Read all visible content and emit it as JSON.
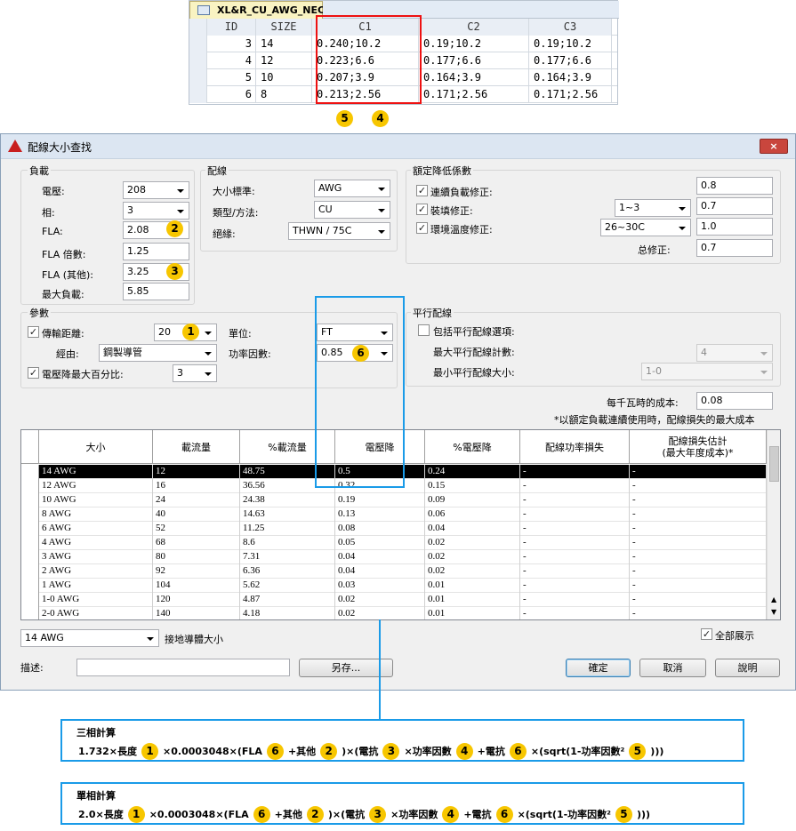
{
  "access_table": {
    "tab_title": "XL&R_CU_AWG_NEC",
    "columns": [
      "ID",
      "SIZE",
      "C1",
      "C2",
      "C3"
    ],
    "rows": [
      [
        "3",
        "14",
        "0.240;10.2",
        "0.19;10.2",
        "0.19;10.2"
      ],
      [
        "4",
        "12",
        "0.223;6.6",
        "0.177;6.6",
        "0.177;6.6"
      ],
      [
        "5",
        "10",
        "0.207;3.9",
        "0.164;3.9",
        "0.164;3.9"
      ],
      [
        "6",
        "8",
        "0.213;2.56",
        "0.171;2.56",
        "0.171;2.56"
      ]
    ],
    "callouts": [
      "5",
      "4"
    ]
  },
  "dialog": {
    "title": "配線大小查找",
    "close": "×",
    "load": {
      "legend": "負載",
      "voltage_label": "電壓:",
      "voltage": "208",
      "phase_label": "相:",
      "phase": "3",
      "fla_label": "FLA:",
      "fla": "2.08",
      "fla_callout": "2",
      "fla_mult_label": "FLA 倍數:",
      "fla_mult": "1.25",
      "fla_other_label": "FLA (其他):",
      "fla_other": "3.25",
      "fla_other_callout": "3",
      "max_load_label": "最大負載:",
      "max_load": "5.85"
    },
    "wiring": {
      "legend": "配線",
      "size_std_label": "大小標準:",
      "size_std": "AWG",
      "type_label": "類型/方法:",
      "type": "CU",
      "insul_label": "絕緣:",
      "insul": "THWN / 75C"
    },
    "derate": {
      "legend": "額定降低係數",
      "cont_label": "連續負載修正:",
      "cont_value": "0.8",
      "fill_label": "裝填修正:",
      "fill_select": "1~3",
      "fill_value": "0.7",
      "temp_label": "環境溫度修正:",
      "temp_select": "26~30C",
      "temp_value": "1.0",
      "total_label": "总修正:",
      "total_value": "0.7"
    },
    "params": {
      "legend": "參數",
      "dist_label": "傳輸距離:",
      "dist": "20",
      "dist_callout": "1",
      "unit_label": "單位:",
      "unit": "FT",
      "via_label": "經由:",
      "via": "鋼製導管",
      "pf_label": "功率因數:",
      "pf": "0.85",
      "pf_callout": "6",
      "vdrop_label": "電壓降最大百分比:",
      "vdrop": "3"
    },
    "parallel": {
      "legend": "平行配線",
      "include_label": "包括平行配線選項:",
      "max_count_label": "最大平行配線計數:",
      "max_count": "4",
      "min_size_label": "最小平行配線大小:",
      "min_size": "1-0"
    },
    "cost_label": "每千瓦時的成本:",
    "cost": "0.08",
    "cost_note": "*以額定負載連續使用時，配線損失的最大成本",
    "grid": {
      "headers": [
        "大小",
        "載流量",
        "%載流量",
        "電壓降",
        "%電壓降",
        "配線功率損失",
        "配線損失估計\n(最大年度成本)*"
      ],
      "rows": [
        [
          "14 AWG",
          "12",
          "48.75",
          "0.5",
          "0.24",
          "-",
          "-"
        ],
        [
          "12 AWG",
          "16",
          "36.56",
          "0.32",
          "0.15",
          "-",
          "-"
        ],
        [
          "10 AWG",
          "24",
          "24.38",
          "0.19",
          "0.09",
          "-",
          "-"
        ],
        [
          "8 AWG",
          "40",
          "14.63",
          "0.13",
          "0.06",
          "-",
          "-"
        ],
        [
          "6 AWG",
          "52",
          "11.25",
          "0.08",
          "0.04",
          "-",
          "-"
        ],
        [
          "4 AWG",
          "68",
          "8.6",
          "0.05",
          "0.02",
          "-",
          "-"
        ],
        [
          "3 AWG",
          "80",
          "7.31",
          "0.04",
          "0.02",
          "-",
          "-"
        ],
        [
          "2 AWG",
          "92",
          "6.36",
          "0.04",
          "0.02",
          "-",
          "-"
        ],
        [
          "1 AWG",
          "104",
          "5.62",
          "0.03",
          "0.01",
          "-",
          "-"
        ],
        [
          "1-0 AWG",
          "120",
          "4.87",
          "0.02",
          "0.01",
          "-",
          "-"
        ],
        [
          "2-0 AWG",
          "140",
          "4.18",
          "0.02",
          "0.01",
          "-",
          "-"
        ]
      ]
    },
    "ground_select": "14 AWG",
    "ground_label": "接地導體大小",
    "show_all_label": "全部展示",
    "desc_label": "描述:",
    "desc_value": "",
    "save_as": "另存...",
    "ok": "確定",
    "cancel": "取消",
    "help": "說明"
  },
  "formulas": {
    "three_phase": {
      "title": "三相計算",
      "parts": [
        "1.732×長度",
        "1",
        "×0.0003048×(FLA",
        "6",
        "+其他",
        "2",
        ")×(電抗",
        "3",
        "×功率因數",
        "4",
        "+電抗",
        "6",
        "×(sqrt(1-功率因數²",
        "5",
        ")))"
      ]
    },
    "single_phase": {
      "title": "單相計算",
      "parts": [
        "2.0×長度",
        "1",
        "×0.0003048×(FLA",
        "6",
        "+其他",
        "2",
        ")×(電抗",
        "3",
        "×功率因數",
        "4",
        "+電抗",
        "6",
        "×(sqrt(1-功率因數²",
        "5",
        ")))"
      ]
    }
  },
  "colors": {
    "callout": "#f7c600",
    "highlight_red": "#e11",
    "highlight_blue": "#1a9be8"
  }
}
